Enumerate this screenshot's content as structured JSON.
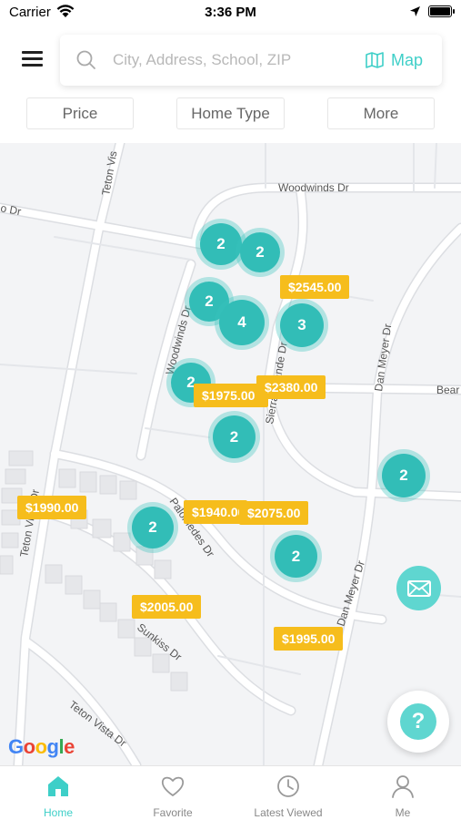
{
  "status_bar": {
    "carrier": "Carrier",
    "time": "3:36 PM"
  },
  "search": {
    "placeholder": "City, Address, School, ZIP",
    "map_label": "Map"
  },
  "filters": [
    {
      "label": "Price"
    },
    {
      "label": "Home Type"
    },
    {
      "label": "More"
    }
  ],
  "map": {
    "streets": {
      "teton_vista_top": "Teton Vis",
      "dr_left": "o Dr",
      "woodwinds_top": "Woodwinds Dr",
      "woodwinds_vertical": "Woodwinds Dr",
      "sierra_grande": "Sierra Grande Dr",
      "dan_meyer_upper": "Dan Meyer Dr",
      "bear": "Bear",
      "teton_vista_left": "Teton Vista Dr",
      "palomedes": "Palomedes Dr",
      "dan_meyer_lower": "Dan Meyer Dr",
      "sunkiss": "Sunkiss Dr",
      "teton_vista_bottom": "Teton Vista Dr"
    },
    "clusters": [
      {
        "count": "2"
      },
      {
        "count": "2"
      },
      {
        "count": "2"
      },
      {
        "count": "4"
      },
      {
        "count": "3"
      },
      {
        "count": "2"
      },
      {
        "count": "2"
      },
      {
        "count": "2"
      },
      {
        "count": "2"
      },
      {
        "count": "2"
      }
    ],
    "price_pins": [
      {
        "label": "$2545.00"
      },
      {
        "label": "$1975.00"
      },
      {
        "label": "$2380.00"
      },
      {
        "label": "$1990.00"
      },
      {
        "label": "$1940.00"
      },
      {
        "label": "$2075.00"
      },
      {
        "label": "$2005.00"
      },
      {
        "label": "$1995.00"
      }
    ],
    "google_logo": "Google"
  },
  "help_button": {
    "label": "?"
  },
  "tabs": [
    {
      "label": "Home",
      "icon": "home-icon",
      "active": true
    },
    {
      "label": "Favorite",
      "icon": "heart-icon",
      "active": false
    },
    {
      "label": "Latest Viewed",
      "icon": "clock-icon",
      "active": false
    },
    {
      "label": "Me",
      "icon": "person-icon",
      "active": false
    }
  ],
  "colors": {
    "accent": "#3ecfc8",
    "cluster": "#32bdb7",
    "price_pin": "#f6bd1c",
    "map_bg": "#f3f4f6"
  }
}
